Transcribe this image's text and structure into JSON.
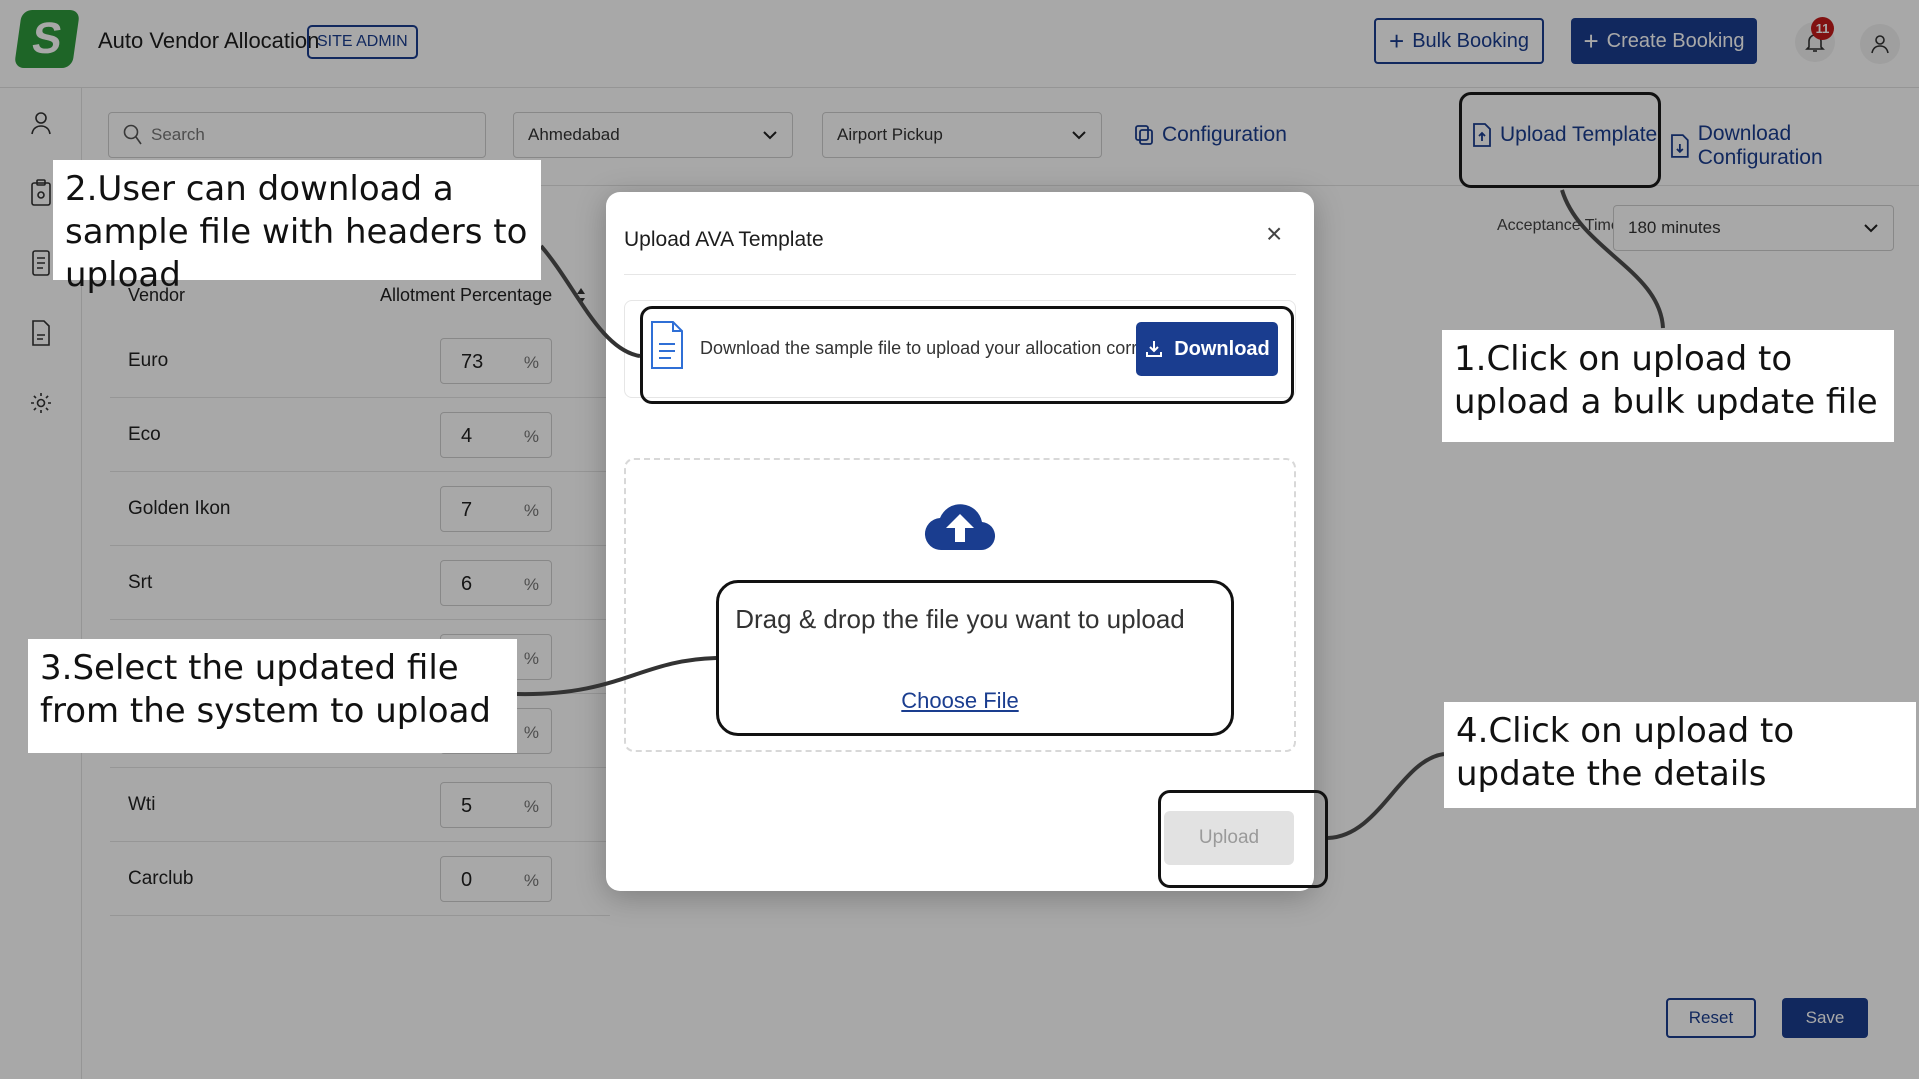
{
  "header": {
    "logo_letter": "S",
    "app_title": "Auto Vendor Allocation",
    "role_badge": "SITE ADMIN",
    "bulk_booking_label": "Bulk Booking",
    "create_booking_label": "Create Booking",
    "notification_count": "11"
  },
  "filters": {
    "search_placeholder": "Search",
    "city_value": "Ahmedabad",
    "service_value": "Airport Pickup",
    "configuration_label": "Configuration",
    "upload_template_label": "Upload Template",
    "download_configuration_label": "Download Configuration",
    "acceptance_label": "Acceptance Time",
    "acceptance_value": "180 minutes"
  },
  "table": {
    "col_vendor": "Vendor",
    "col_allotment": "Allotment Percentage",
    "unit": "%",
    "rows": [
      {
        "name": "Euro",
        "value": "73"
      },
      {
        "name": "Eco",
        "value": "4"
      },
      {
        "name": "Golden Ikon",
        "value": "7"
      },
      {
        "name": "Srt",
        "value": "6"
      },
      {
        "name": "",
        "value": ""
      },
      {
        "name": "",
        "value": ""
      },
      {
        "name": "Wti",
        "value": "5"
      },
      {
        "name": "Carclub",
        "value": "0"
      }
    ]
  },
  "footer": {
    "reset_label": "Reset",
    "save_label": "Save"
  },
  "modal": {
    "title": "Upload AVA Template",
    "close_glyph": "×",
    "download_text": "Download the sample file to upload your allocation correctly",
    "download_button": "Download",
    "drop_text": "Drag & drop the file you want to upload",
    "choose_file": "Choose File",
    "upload_button": "Upload"
  },
  "annotations": {
    "step1": "1.Click on upload to upload a bulk update file",
    "step2": "2.User can download a sample file with headers to upload",
    "step3": "3.Select the updated file from the system to upload",
    "step4": "4.Click on upload to update the details"
  },
  "colors": {
    "primary": "#1a3d8f",
    "logo_green": "#2e9a3c",
    "badge_red": "#c41b1b",
    "disabled_bg": "#e2e2e2"
  }
}
